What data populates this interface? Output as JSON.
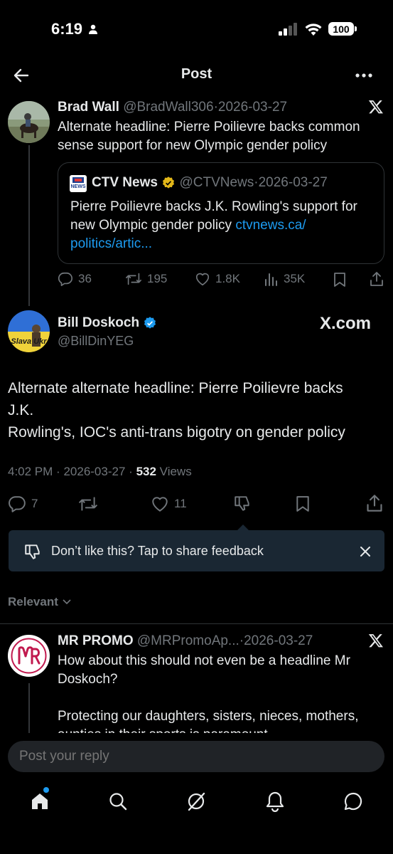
{
  "status_bar": {
    "time": "6:19",
    "battery": "100"
  },
  "header": {
    "title": "Post"
  },
  "parent_tweet": {
    "name": "Brad Wall",
    "handle": "@BradWall306",
    "sep": "·",
    "date": "2026-03-27",
    "text_line1": "Alternate headline: Pierre Poilievre backs common",
    "text_line2": "sense support for new Olympic gender policy",
    "quote": {
      "logo_text": "NEWS",
      "name": "CTV News",
      "handle": "@CTVNews",
      "sep": "·",
      "date": "2026-03-27",
      "text_line1": "Pierre Poilievre backs J.K. Rowling's support for",
      "text_line2_prefix": "new Olympic gender policy ",
      "link_part1": "ctvnews.ca/",
      "link_part2": "politics/artic..."
    },
    "actions": {
      "replies": "36",
      "reposts": "195",
      "likes": "1.8K",
      "views": "35K"
    }
  },
  "main_tweet": {
    "avatar_text": "Slava Ukr",
    "name": "Bill Doskoch",
    "handle": "@BillDinYEG",
    "watermark": "X.com",
    "text_line1": "Alternate alternate headline: Pierre Poilievre backs",
    "text_line2": "J.K.",
    "text_line3": "Rowling's, IOC's anti-trans bigotry on gender policy",
    "time": "4:02 PM",
    "sep1": "·",
    "date": "2026-03-27",
    "sep2": "·",
    "views_count": "532",
    "views_label": " Views",
    "actions": {
      "replies": "7",
      "likes": "11"
    }
  },
  "feedback": {
    "text": "Don’t like this? Tap to share feedback"
  },
  "sort": {
    "label": "Relevant"
  },
  "reply": {
    "name": "MR PROMO",
    "handle": "@MRPromoAp...",
    "sep": "·",
    "date": "2026-03-27",
    "text_line1": "How about this should not even be a headline Mr",
    "text_line2": "Doskoch?",
    "text_line3": "Protecting our daughters, sisters, nieces, mothers,",
    "text_line4": "aunties in their sports is paramount"
  },
  "composer": {
    "placeholder": "Post your reply"
  },
  "colors": {
    "accent": "#1d9bf0",
    "background": "#000000",
    "muted": "#71767b",
    "verified_blue": "#1d9bf0",
    "verified_gold": "#e2b719",
    "promo_red": "#c1194e"
  },
  "icons": [
    "back-arrow-icon",
    "more-icon",
    "x-logo-icon",
    "reply-icon",
    "repost-icon",
    "like-icon",
    "views-icon",
    "bookmark-icon",
    "share-icon",
    "dislike-icon",
    "close-icon",
    "chevron-down-icon",
    "home-icon",
    "search-icon",
    "grok-icon",
    "notifications-icon",
    "messages-icon"
  ]
}
